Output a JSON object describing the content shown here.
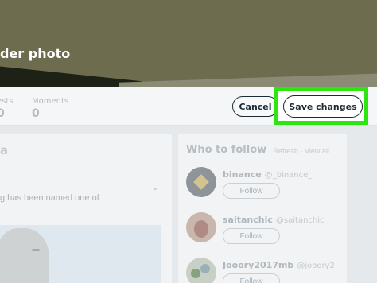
{
  "header": {
    "photo_label": "der photo"
  },
  "stats": [
    {
      "label": "ests",
      "value": "0"
    },
    {
      "label": "Moments",
      "value": "0"
    }
  ],
  "actions": {
    "cancel_label": "Cancel",
    "save_label": "Save changes",
    "highlight_color": "#2ee60f"
  },
  "tweet": {
    "heading": "a",
    "text": "g has been named one of"
  },
  "who_to_follow": {
    "title": "Who to follow",
    "links": "· Refresh · View all",
    "accounts": [
      {
        "name": "binance",
        "handle": "@_binance_",
        "follow_label": "Follow"
      },
      {
        "name": "saitanchic",
        "handle": "@saitanchic",
        "follow_label": "Follow"
      },
      {
        "name": "Jooory2017mb",
        "handle": "@jooory2",
        "follow_label": "Follow"
      }
    ]
  }
}
